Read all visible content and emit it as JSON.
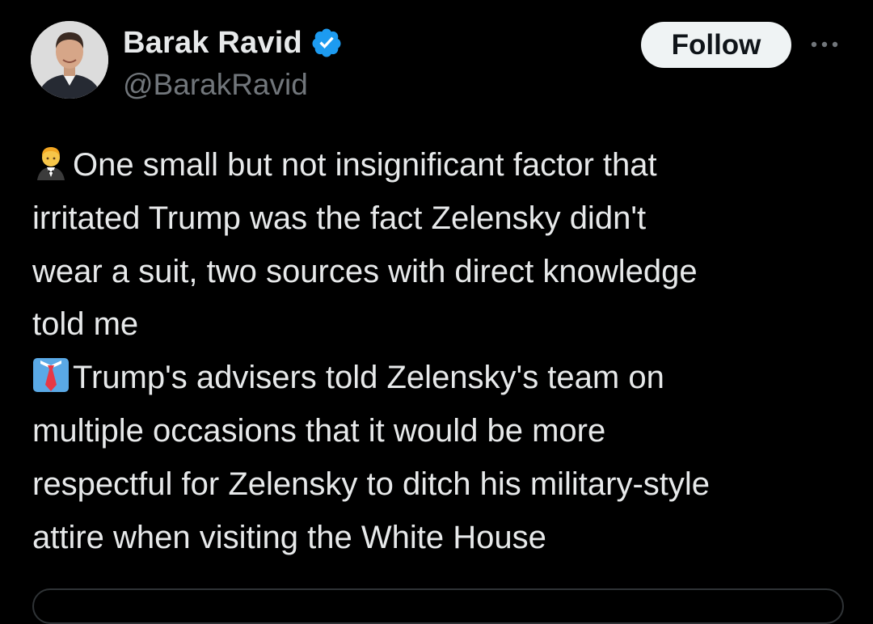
{
  "author": {
    "display_name": "Barak Ravid",
    "handle": "@BarakRavid",
    "verified_icon": "verified-badge-icon",
    "verified_color": "#1d9bf0"
  },
  "actions": {
    "follow_label": "Follow",
    "more_icon": "more-options-icon"
  },
  "tweet": {
    "lines": [
      "One small but not insignificant factor that",
      "irritated Trump was the fact Zelensky didn't",
      "wear a suit, two sources with direct knowledge",
      "told me",
      "Trump's advisers told Zelensky's team on",
      "multiple occasions that it would be more",
      "respectful for Zelensky to ditch his military-style",
      "attire when visiting the White House"
    ],
    "emojis": [
      "person-in-tuxedo-emoji",
      "necktie-emoji"
    ]
  },
  "colors": {
    "background": "#000000",
    "text": "#e7e9ea",
    "secondary_text": "#71767b",
    "follow_bg": "#eff3f4"
  }
}
